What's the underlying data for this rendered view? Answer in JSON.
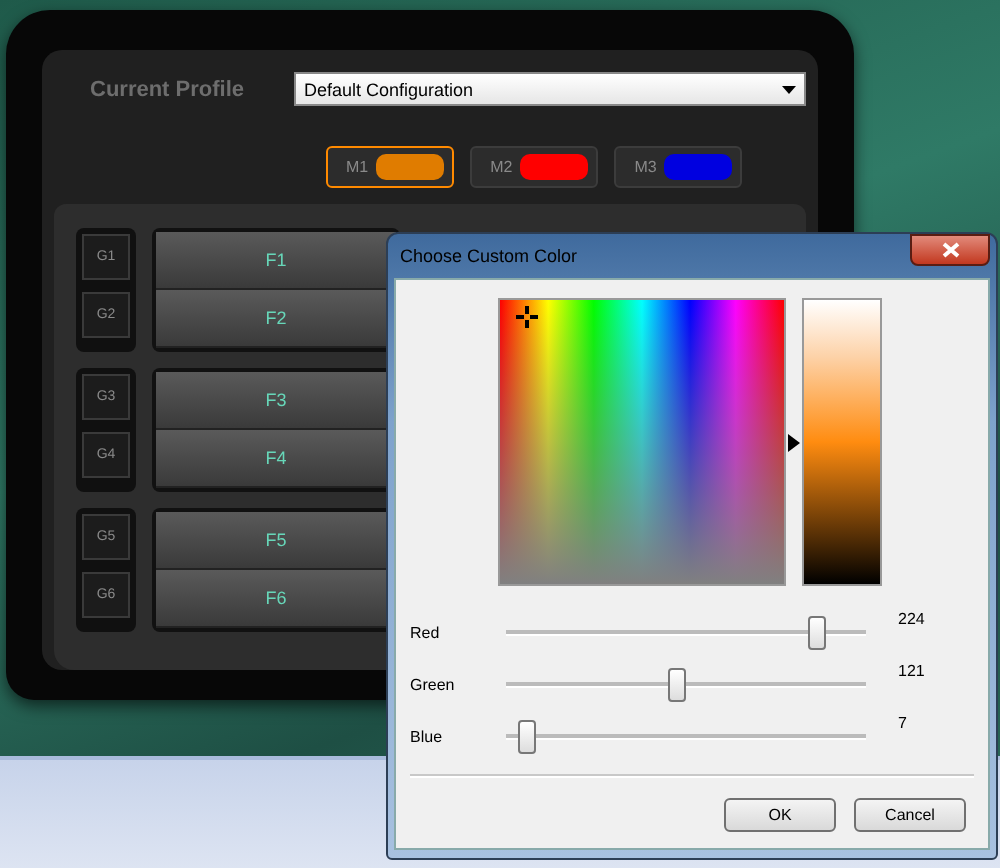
{
  "profile": {
    "label": "Current Profile",
    "value": "Default Configuration"
  },
  "modes": [
    {
      "label": "M1",
      "color": "#e07c00",
      "selected": true
    },
    {
      "label": "M2",
      "color": "#ff0000",
      "selected": false
    },
    {
      "label": "M3",
      "color": "#0000e0",
      "selected": false
    }
  ],
  "key_groups": [
    {
      "g_keys": [
        "G1",
        "G2"
      ],
      "f_keys": [
        "F1",
        "F2"
      ]
    },
    {
      "g_keys": [
        "G3",
        "G4"
      ],
      "f_keys": [
        "F3",
        "F4"
      ]
    },
    {
      "g_keys": [
        "G5",
        "G6"
      ],
      "f_keys": [
        "F5",
        "F6"
      ]
    }
  ],
  "dialog": {
    "title": "Choose Custom Color",
    "sliders": [
      {
        "name": "Red",
        "level": 0.88,
        "reading": "224"
      },
      {
        "name": "Green",
        "level": 0.47,
        "reading": "121"
      },
      {
        "name": "Blue",
        "level": 0.03,
        "reading": "7"
      }
    ],
    "buttons": [
      "OK",
      "Cancel"
    ]
  }
}
